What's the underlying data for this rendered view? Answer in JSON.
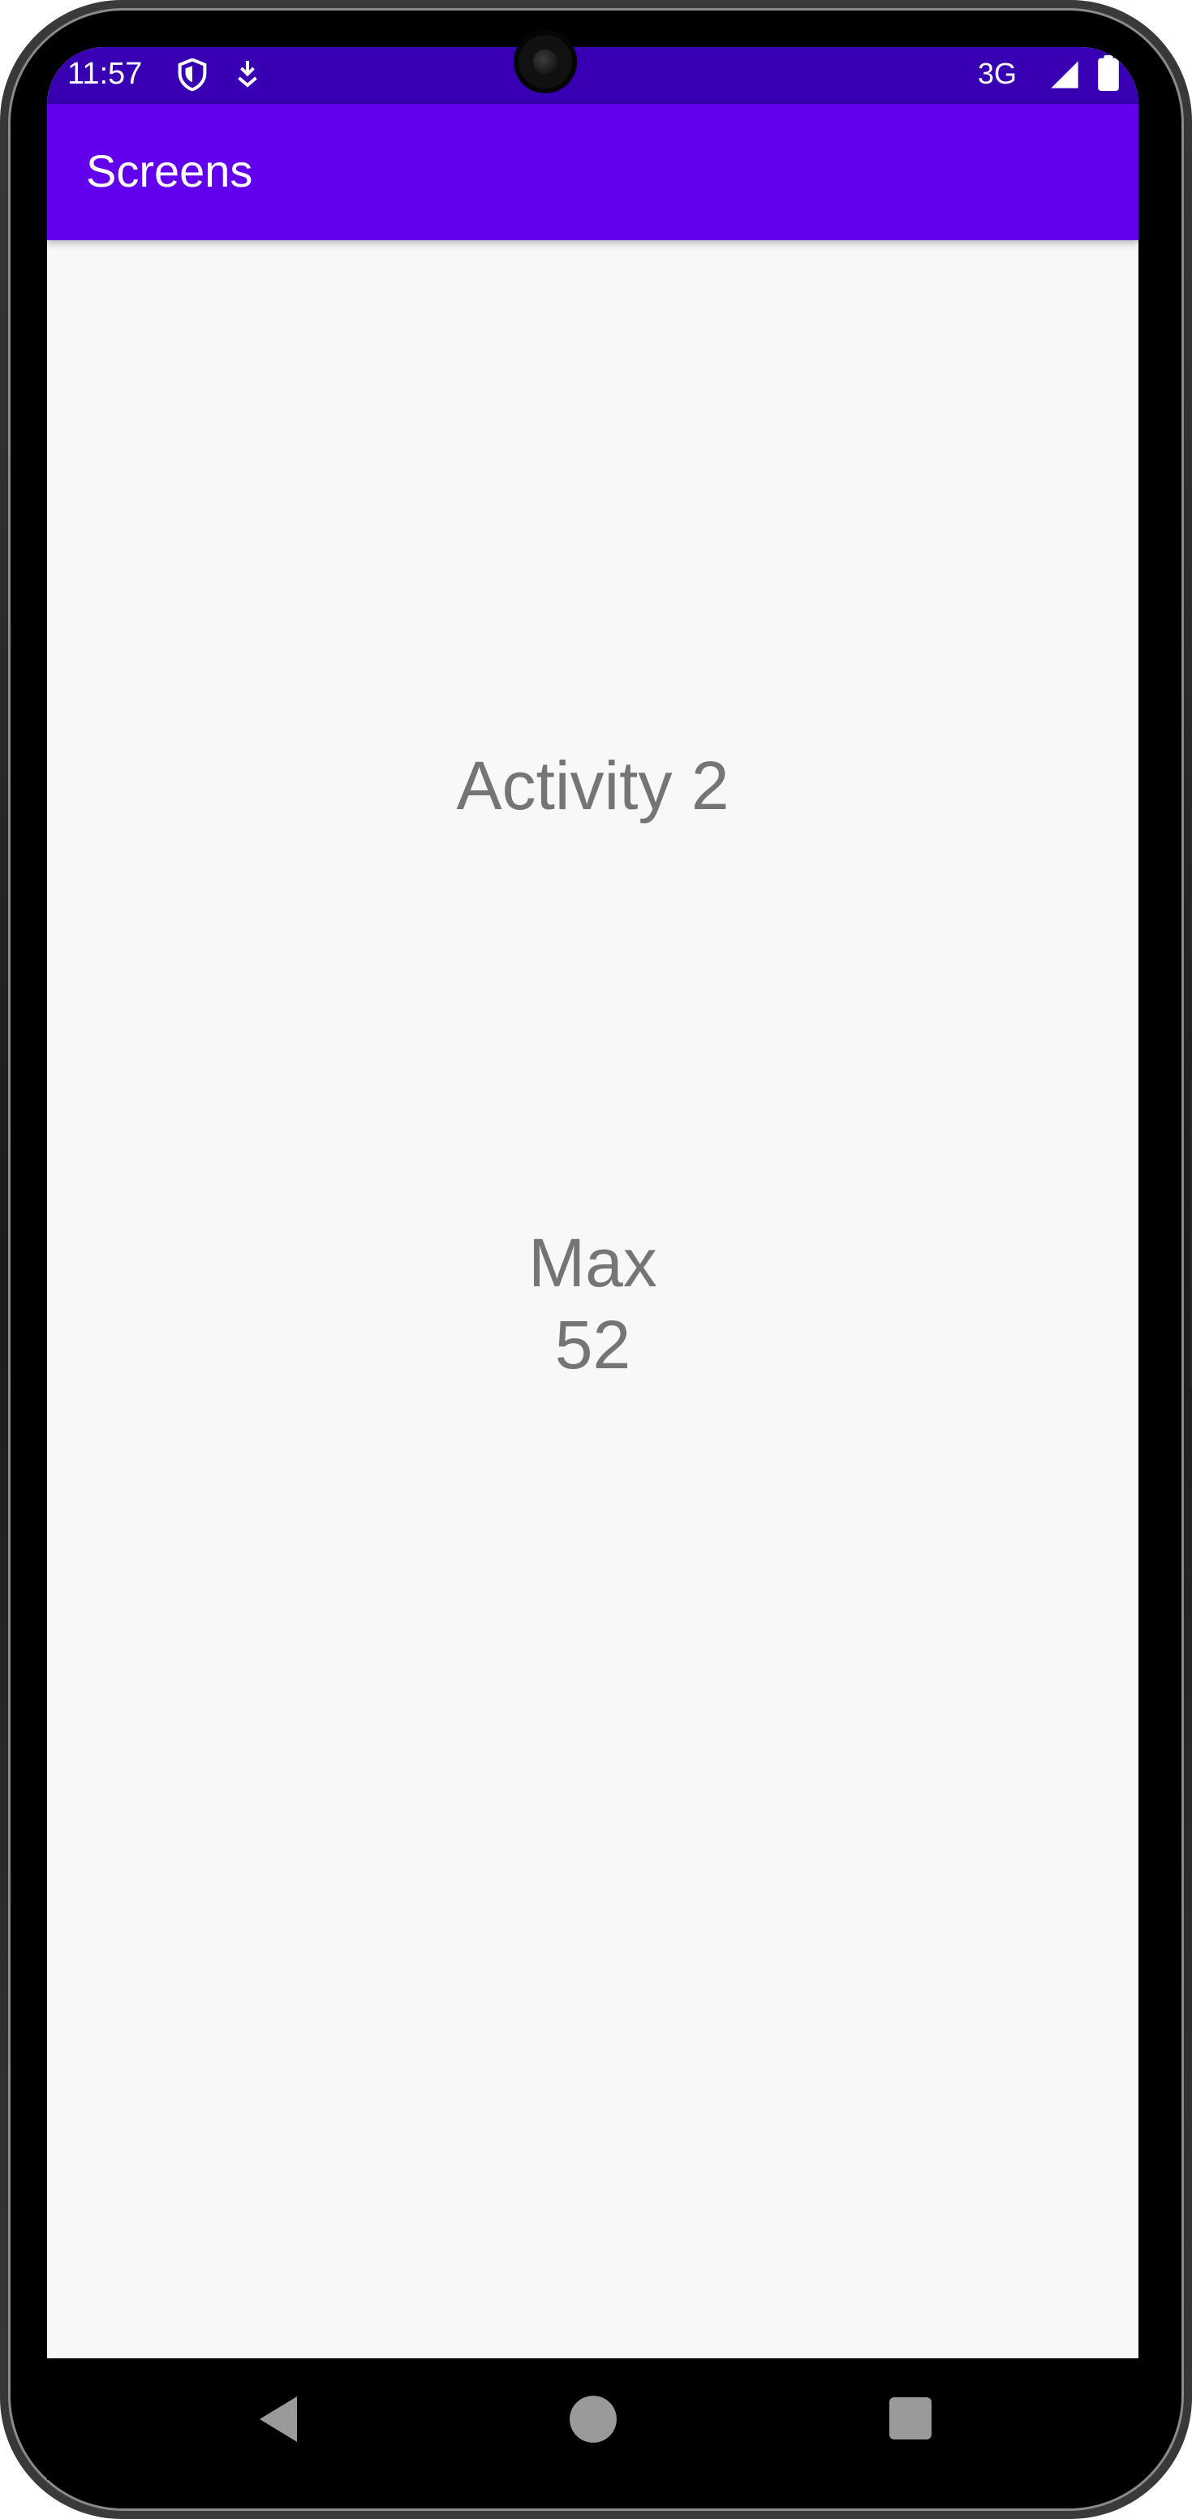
{
  "status_bar": {
    "time": "11:57",
    "network": "3G",
    "icons": [
      "shield-icon",
      "download-icon",
      "signal-icon",
      "battery-icon"
    ]
  },
  "app_bar": {
    "title": "Screens",
    "color": "#6200ee"
  },
  "content": {
    "heading": "Activity 2",
    "name": "Max",
    "value": "52"
  },
  "nav_bar": {
    "buttons": [
      "back-icon",
      "home-icon",
      "recents-icon"
    ]
  },
  "colors": {
    "status_bar": "#3700b3",
    "app_bar": "#6200ee",
    "background": "#f8f8f8",
    "text": "#757575"
  }
}
